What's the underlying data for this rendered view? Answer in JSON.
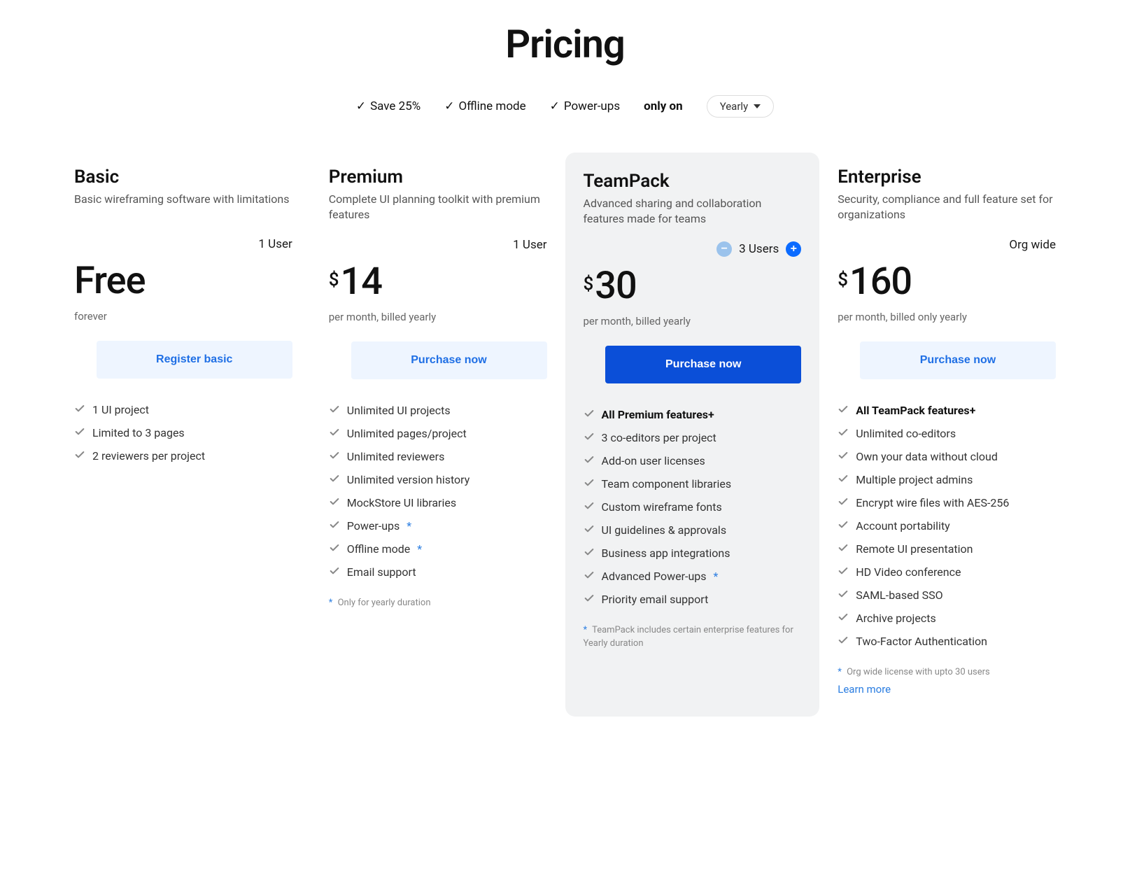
{
  "header": {
    "title": "Pricing"
  },
  "perks": {
    "items": [
      "Save 25%",
      "Offline mode",
      "Power-ups"
    ],
    "only_on_label": "only on",
    "duration_selected": "Yearly"
  },
  "plans": [
    {
      "name": "Basic",
      "description": "Basic wireframing software with limitations",
      "users_label": "1 User",
      "has_stepper": false,
      "price_text": "Free",
      "price_is_free": true,
      "currency": "",
      "amount": "",
      "billing": "forever",
      "cta_label": "Register basic",
      "cta_style": "light",
      "features": [
        {
          "text": "1 UI project",
          "bold": false,
          "star": false
        },
        {
          "text": "Limited to 3 pages",
          "bold": false,
          "star": false
        },
        {
          "text": "2 reviewers per project",
          "bold": false,
          "star": false
        }
      ],
      "footnote": "",
      "learn_more": ""
    },
    {
      "name": "Premium",
      "description": "Complete UI planning toolkit with premium features",
      "users_label": "1 User",
      "has_stepper": false,
      "price_text": "",
      "price_is_free": false,
      "currency": "$",
      "amount": "14",
      "billing": "per month, billed yearly",
      "cta_label": "Purchase now",
      "cta_style": "light",
      "features": [
        {
          "text": "Unlimited UI projects",
          "bold": false,
          "star": false
        },
        {
          "text": "Unlimited pages/project",
          "bold": false,
          "star": false
        },
        {
          "text": "Unlimited reviewers",
          "bold": false,
          "star": false
        },
        {
          "text": "Unlimited version history",
          "bold": false,
          "star": false
        },
        {
          "text": "MockStore UI libraries",
          "bold": false,
          "star": false
        },
        {
          "text": "Power-ups",
          "bold": false,
          "star": true
        },
        {
          "text": "Offline mode",
          "bold": false,
          "star": true
        },
        {
          "text": "Email support",
          "bold": false,
          "star": false
        }
      ],
      "footnote": "Only for yearly duration",
      "learn_more": ""
    },
    {
      "name": "TeamPack",
      "description": "Advanced sharing and collaboration features made for teams",
      "users_label": "3 Users",
      "has_stepper": true,
      "price_text": "",
      "price_is_free": false,
      "currency": "$",
      "amount": "30",
      "billing": "per month, billed yearly",
      "cta_label": "Purchase now",
      "cta_style": "primary",
      "features": [
        {
          "text": "All Premium features+",
          "bold": true,
          "star": false
        },
        {
          "text": "3 co-editors per project",
          "bold": false,
          "star": false
        },
        {
          "text": "Add-on user licenses",
          "bold": false,
          "star": false
        },
        {
          "text": "Team component libraries",
          "bold": false,
          "star": false
        },
        {
          "text": "Custom wireframe fonts",
          "bold": false,
          "star": false
        },
        {
          "text": "UI guidelines & approvals",
          "bold": false,
          "star": false
        },
        {
          "text": "Business app integrations",
          "bold": false,
          "star": false
        },
        {
          "text": "Advanced Power-ups",
          "bold": false,
          "star": true
        },
        {
          "text": "Priority email support",
          "bold": false,
          "star": false
        }
      ],
      "footnote": "TeamPack includes certain enterprise features for Yearly duration",
      "learn_more": ""
    },
    {
      "name": "Enterprise",
      "description": "Security, compliance and full feature set for organizations",
      "users_label": "Org wide",
      "has_stepper": false,
      "price_text": "",
      "price_is_free": false,
      "currency": "$",
      "amount": "160",
      "billing": "per month, billed only yearly",
      "cta_label": "Purchase now",
      "cta_style": "light",
      "features": [
        {
          "text": "All TeamPack features+",
          "bold": true,
          "star": false
        },
        {
          "text": "Unlimited co-editors",
          "bold": false,
          "star": false
        },
        {
          "text": "Own your data without cloud",
          "bold": false,
          "star": false
        },
        {
          "text": "Multiple project admins",
          "bold": false,
          "star": false
        },
        {
          "text": "Encrypt wire files with AES-256",
          "bold": false,
          "star": false
        },
        {
          "text": "Account portability",
          "bold": false,
          "star": false
        },
        {
          "text": "Remote UI presentation",
          "bold": false,
          "star": false
        },
        {
          "text": "HD Video conference",
          "bold": false,
          "star": false
        },
        {
          "text": "SAML-based SSO",
          "bold": false,
          "star": false
        },
        {
          "text": "Archive projects",
          "bold": false,
          "star": false
        },
        {
          "text": "Two-Factor Authentication",
          "bold": false,
          "star": false
        }
      ],
      "footnote": "Org wide license with upto 30 users",
      "learn_more": "Learn more"
    }
  ]
}
